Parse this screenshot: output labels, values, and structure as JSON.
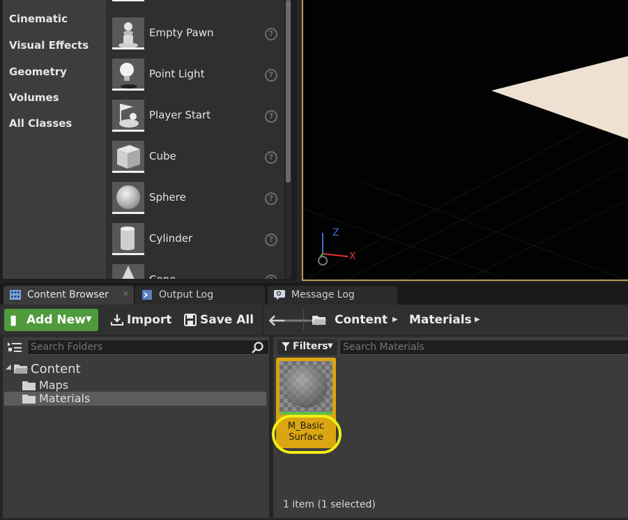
{
  "place_actors": {
    "categories": [
      "Cinematic",
      "Visual Effects",
      "Geometry",
      "Volumes",
      "All Classes"
    ],
    "actors": [
      {
        "label": "Empty Pawn",
        "icon": "pawn-icon"
      },
      {
        "label": "Point Light",
        "icon": "lightbulb-icon"
      },
      {
        "label": "Player Start",
        "icon": "player-start-icon"
      },
      {
        "label": "Cube",
        "icon": "cube-icon"
      },
      {
        "label": "Sphere",
        "icon": "sphere-icon"
      },
      {
        "label": "Cylinder",
        "icon": "cylinder-icon"
      },
      {
        "label": "Cone",
        "icon": "cone-icon"
      }
    ],
    "help_glyph": "?"
  },
  "viewport": {
    "axis_labels": {
      "x": "X",
      "z": "Z"
    },
    "colors": {
      "x": "#e0352b",
      "y": "#3ad33a",
      "z": "#3b6fe0",
      "frame": "#b89a55"
    }
  },
  "tabs": [
    {
      "label": "Content Browser",
      "active": true,
      "icon": "content-browser-icon"
    },
    {
      "label": "Output Log",
      "active": false,
      "icon": "output-log-icon"
    },
    {
      "label": "Message Log",
      "active": false,
      "icon": "message-log-icon"
    }
  ],
  "toolbar": {
    "add_new": "Add New",
    "import": "Import",
    "save_all": "Save All",
    "breadcrumbs": [
      "Content",
      "Materials"
    ],
    "accent": "#4e9a3c"
  },
  "folders": {
    "search_placeholder": "Search Folders",
    "tree": [
      {
        "label": "Content",
        "level": 0,
        "selected": false
      },
      {
        "label": "Maps",
        "level": 1,
        "selected": false
      },
      {
        "label": "Materials",
        "level": 1,
        "selected": true
      }
    ]
  },
  "assets": {
    "filters_label": "Filters",
    "search_placeholder": "Search Materials",
    "items": [
      {
        "name": "M_Basic\nSurface",
        "selected": true,
        "highlight_color": "#f2ee14",
        "tile_color": "#dba411"
      }
    ],
    "status": "1 item (1 selected)"
  }
}
